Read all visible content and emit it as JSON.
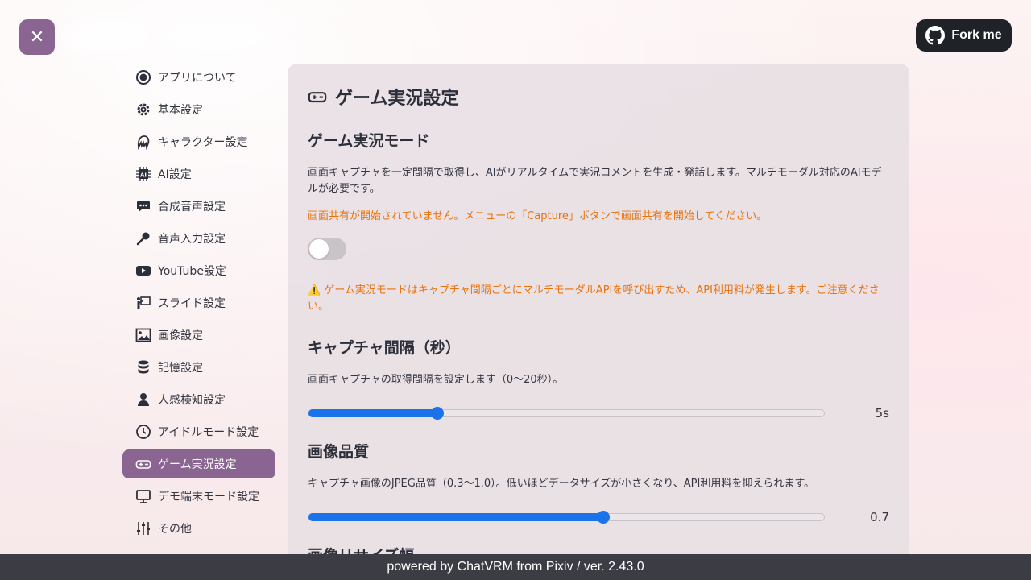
{
  "close_label": "✕",
  "fork": {
    "label": "Fork me"
  },
  "sidebar": {
    "items": [
      {
        "label": "アプリについて",
        "icon": "info-icon"
      },
      {
        "label": "基本設定",
        "icon": "gear-icon"
      },
      {
        "label": "キャラクター設定",
        "icon": "character-icon"
      },
      {
        "label": "AI設定",
        "icon": "ai-chip-icon"
      },
      {
        "label": "合成音声設定",
        "icon": "speech-bubble-icon"
      },
      {
        "label": "音声入力設定",
        "icon": "microphone-icon"
      },
      {
        "label": "YouTube設定",
        "icon": "youtube-icon"
      },
      {
        "label": "スライド設定",
        "icon": "presentation-icon"
      },
      {
        "label": "画像設定",
        "icon": "image-icon"
      },
      {
        "label": "記憶設定",
        "icon": "database-icon"
      },
      {
        "label": "人感検知設定",
        "icon": "person-icon"
      },
      {
        "label": "アイドルモード設定",
        "icon": "clock-icon"
      },
      {
        "label": "ゲーム実況設定",
        "icon": "gamepad-icon",
        "active": true
      },
      {
        "label": "デモ端末モード設定",
        "icon": "monitor-icon"
      },
      {
        "label": "その他",
        "icon": "sliders-icon"
      }
    ]
  },
  "panel": {
    "title": "ゲーム実況設定",
    "mode": {
      "heading": "ゲーム実況モード",
      "description": "画面キャプチャを一定間隔で取得し、AIがリアルタイムで実況コメントを生成・発話します。マルチモーダル対応のAIモデルが必要です。",
      "share_warning": "画面共有が開始されていません。メニューの「Capture」ボタンで画面共有を開始してください。",
      "toggle_on": false,
      "cost_warning": "⚠️ ゲーム実況モードはキャプチャ間隔ごとにマルチモーダルAPIを呼び出すため、API利用料が発生します。ご注意ください。"
    },
    "interval": {
      "heading": "キャプチャ間隔（秒）",
      "description": "画面キャプチャの取得間隔を設定します（0〜20秒）。",
      "value": 5,
      "min": 0,
      "max": 20,
      "display": "5s"
    },
    "quality": {
      "heading": "画像品質",
      "description": "キャプチャ画像のJPEG品質（0.3〜1.0）。低いほどデータサイズが小さくなり、API利用料を抑えられます。",
      "value": 0.7,
      "min": 0.3,
      "max": 1.0,
      "display": "0.7"
    },
    "resize": {
      "heading": "画像リサイズ幅"
    }
  },
  "footer": {
    "text": "powered by ChatVRM from Pixiv / ver. 2.43.0"
  },
  "colors": {
    "accent": "#8a6592",
    "slider": "#1a73e8",
    "warning": "#e8720c"
  }
}
